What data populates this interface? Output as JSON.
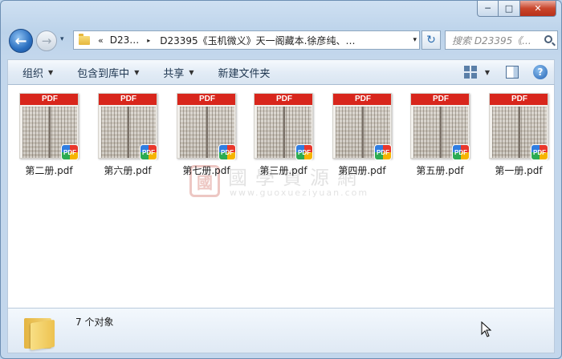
{
  "window": {
    "caption": {
      "minimize": "─",
      "maximize": "□",
      "close": "✕"
    }
  },
  "nav": {
    "back_glyph": "←",
    "forward_glyph": "→",
    "address": {
      "chevron": "«",
      "crumb_root": "D23…",
      "separator": "▸",
      "crumb_current": "D23395《玉机微义》天一阁藏本.徐彦纯、…"
    },
    "refresh_glyph": "↻",
    "search_placeholder": "搜索 D23395《...",
    "dropdown_glyph": "▾"
  },
  "toolbar": {
    "organize": "组织",
    "include_library": "包含到库中",
    "share": "共享",
    "new_folder": "新建文件夹",
    "help": "?"
  },
  "files": [
    {
      "name": "第二册.pdf",
      "banner": "PDF",
      "badge": "PDF"
    },
    {
      "name": "第六册.pdf",
      "banner": "PDF",
      "badge": "PDF"
    },
    {
      "name": "第七册.pdf",
      "banner": "PDF",
      "badge": "PDF"
    },
    {
      "name": "第三册.pdf",
      "banner": "PDF",
      "badge": "PDF"
    },
    {
      "name": "第四册.pdf",
      "banner": "PDF",
      "badge": "PDF"
    },
    {
      "name": "第五册.pdf",
      "banner": "PDF",
      "badge": "PDF"
    },
    {
      "name": "第一册.pdf",
      "banner": "PDF",
      "badge": "PDF"
    }
  ],
  "watermark": {
    "seal": "國",
    "title": "國學資源網",
    "url": "www.guoxueziyuan.com"
  },
  "details": {
    "object_count": "7 个对象"
  },
  "colors": {
    "pdf_banner": "#d8261c",
    "accent": "#2a6fc0"
  }
}
